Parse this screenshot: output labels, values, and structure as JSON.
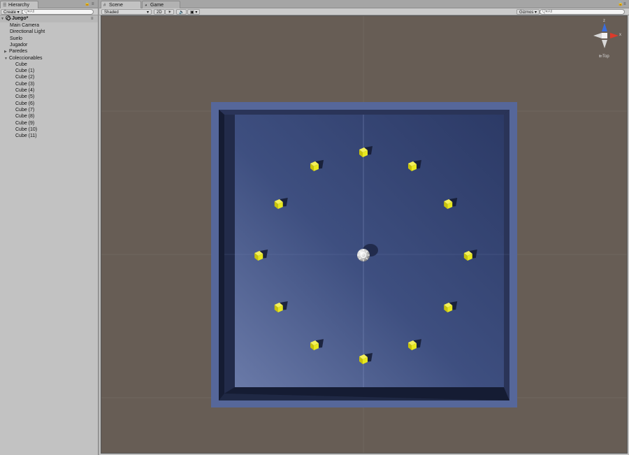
{
  "hierarchy": {
    "tab_label": "Hierarchy",
    "create_label": "Create",
    "search_placeholder": "Q▾All",
    "scene_name": "Juego*",
    "items": [
      {
        "label": "Main Camera",
        "depth": 1
      },
      {
        "label": "Directional Light",
        "depth": 1
      },
      {
        "label": "Suelo",
        "depth": 1
      },
      {
        "label": "Jugador",
        "depth": 1
      },
      {
        "label": "Paredes",
        "depth": 1,
        "foldout": "collapsed"
      },
      {
        "label": "Coleccionables",
        "depth": 1,
        "foldout": "expanded"
      },
      {
        "label": "Cube",
        "depth": 2
      },
      {
        "label": "Cube (1)",
        "depth": 2
      },
      {
        "label": "Cube (2)",
        "depth": 2
      },
      {
        "label": "Cube (3)",
        "depth": 2
      },
      {
        "label": "Cube (4)",
        "depth": 2
      },
      {
        "label": "Cube (5)",
        "depth": 2
      },
      {
        "label": "Cube (6)",
        "depth": 2
      },
      {
        "label": "Cube (7)",
        "depth": 2
      },
      {
        "label": "Cube (8)",
        "depth": 2
      },
      {
        "label": "Cube (9)",
        "depth": 2
      },
      {
        "label": "Cube (10)",
        "depth": 2
      },
      {
        "label": "Cube (11)",
        "depth": 2
      }
    ]
  },
  "scene_view": {
    "tabs": [
      {
        "label": "Scene",
        "icon": "grid-icon",
        "active": true
      },
      {
        "label": "Game",
        "icon": "pacman-icon",
        "active": false
      }
    ],
    "shading_mode": "Shaded",
    "toggle_2d": "2D",
    "gizmos_label": "Gizmos",
    "search_placeholder": "Q▾All",
    "view_label": "Top",
    "axis_labels": {
      "z": "z",
      "x": "x"
    }
  },
  "colors": {
    "viewport_bg": "#675d55",
    "floor": "#3a4a7c",
    "wall": "#50608f",
    "collectible": "#e8e81e",
    "player": "#d8d8d8"
  }
}
